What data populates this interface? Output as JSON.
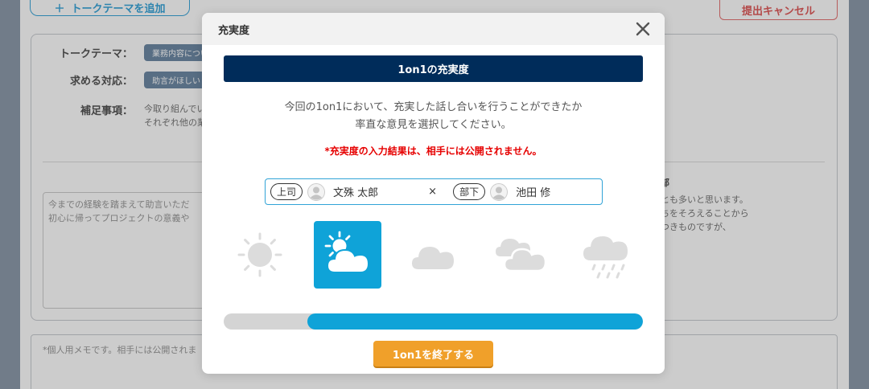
{
  "background": {
    "add_theme_label": "トークテーマを追加",
    "cancel_label": "提出キャンセル",
    "rows": [
      {
        "label": "トークテーマ：",
        "value": "業務内容について"
      },
      {
        "label": "求める対応：",
        "value": "助言がほしい"
      }
    ],
    "supplement_label": "補足事項：",
    "supplement_text_1": "今取り組んでいる",
    "supplement_text_2": "それぞれ他の業務",
    "textarea_line_1": "今までの経験を踏まえて助言いただ",
    "textarea_line_2": "初心に帰ってプロジェクトの意義や",
    "right_heading": "部",
    "right_line_1": "とも多いと思います。",
    "right_line_2": "ちをそろえることから",
    "right_line_3": "つきものですが、",
    "memo_placeholder": "*個人用メモです。相手には公開されま"
  },
  "modal": {
    "title": "充実度",
    "banner": "1on1の充実度",
    "description_line_1": "今回の1on1において、充実した話し合いを行うことができたか",
    "description_line_2": "率直な意見を選択してください。",
    "notice": "*充実度の入力結果は、相手には公開されません。",
    "boss": {
      "role": "上司",
      "name": "文殊 太郎"
    },
    "separator": "×",
    "subordinate": {
      "role": "部下",
      "name": "池田 修"
    },
    "weather_options": [
      "sunny-icon",
      "sun-behind-cloud-icon",
      "cloud-icon",
      "double-cloud-icon",
      "rain-cloud-icon"
    ],
    "selected_weather_index": 1,
    "progress_fraction": 0.8,
    "end_button": "1on1を終了する"
  },
  "colors": {
    "navy": "#002c5a",
    "accent_blue": "#0fa3d8",
    "orange": "#f0a02a",
    "notice_red": "#e60000"
  }
}
